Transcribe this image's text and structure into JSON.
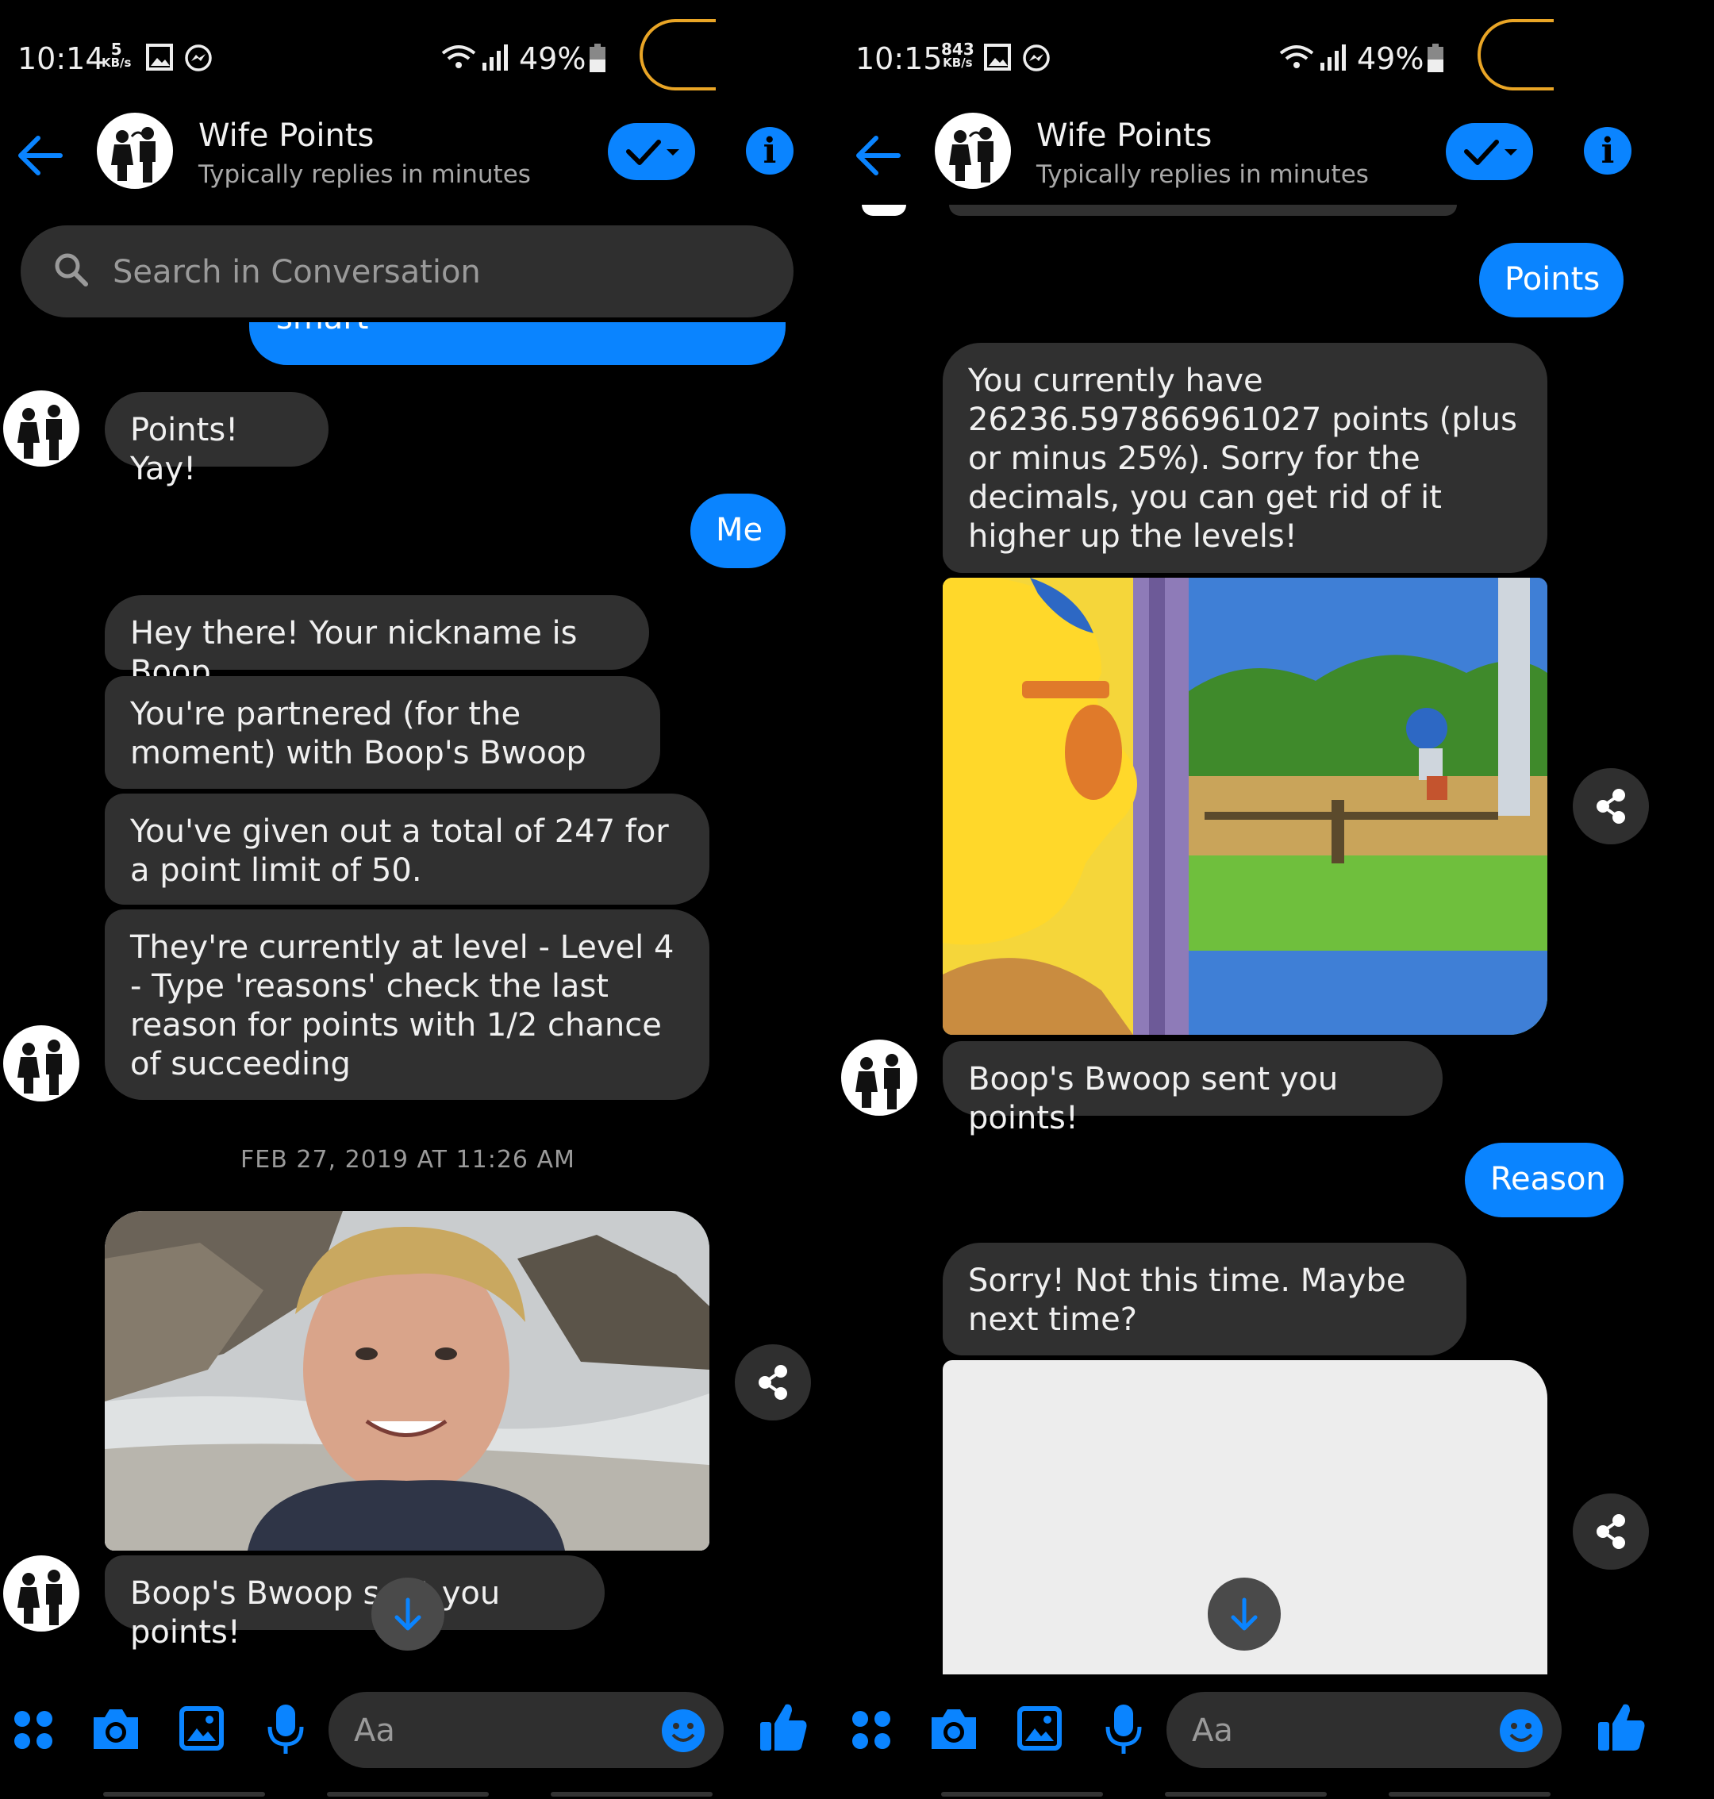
{
  "left": {
    "status": {
      "time": "10:14",
      "speed_value": "5",
      "speed_unit": "KB/s",
      "battery": "49%"
    },
    "header": {
      "title": "Wife Points",
      "subtitle": "Typically replies in minutes"
    },
    "search": {
      "placeholder": "Search in Conversation"
    },
    "partial_out": "smart",
    "messages": {
      "points_yay": "Points! Yay!",
      "me": "Me",
      "nickname": "Hey there! Your nickname is Boop",
      "partnered": "You're partnered (for the moment) with Boop's Bwoop",
      "given": "You've given out a total of 247 for a point limit of 50.",
      "level": "They're currently at level - Level 4 - Type 'reasons' check the last reason for points with 1/2 chance of succeeding",
      "timestamp": "FEB 27, 2019 AT 11:26 AM",
      "sent_points": "Boop's Bwoop sent you points!"
    },
    "composer": {
      "placeholder": "Aa"
    }
  },
  "right": {
    "status": {
      "time": "10:15",
      "speed_value": "843",
      "speed_unit": "KB/s",
      "battery": "49%"
    },
    "header": {
      "title": "Wife Points",
      "subtitle": "Typically replies in minutes"
    },
    "messages": {
      "points": "Points",
      "current": "You currently have 26236.597866961027 points (plus or minus 25%). Sorry for the decimals, you can get rid of it higher up the levels!",
      "sent_points": "Boop's Bwoop sent you points!",
      "reason": "Reason",
      "sorry": "Sorry! Not this time. Maybe next time?"
    },
    "composer": {
      "placeholder": "Aa"
    }
  },
  "colors": {
    "accent": "#0a84ff",
    "bubble_in": "#303030",
    "background": "#000000",
    "status_ring": "#e9a526"
  },
  "icons": [
    "arrow-left-icon",
    "check-dropdown-icon",
    "info-icon",
    "search-icon",
    "share-icon",
    "arrow-down-icon",
    "apps-icon",
    "camera-icon",
    "gallery-icon",
    "mic-icon",
    "emoji-icon",
    "thumbs-up-icon",
    "wifi-icon",
    "signal-icon",
    "battery-icon",
    "image-icon",
    "messenger-icon"
  ]
}
